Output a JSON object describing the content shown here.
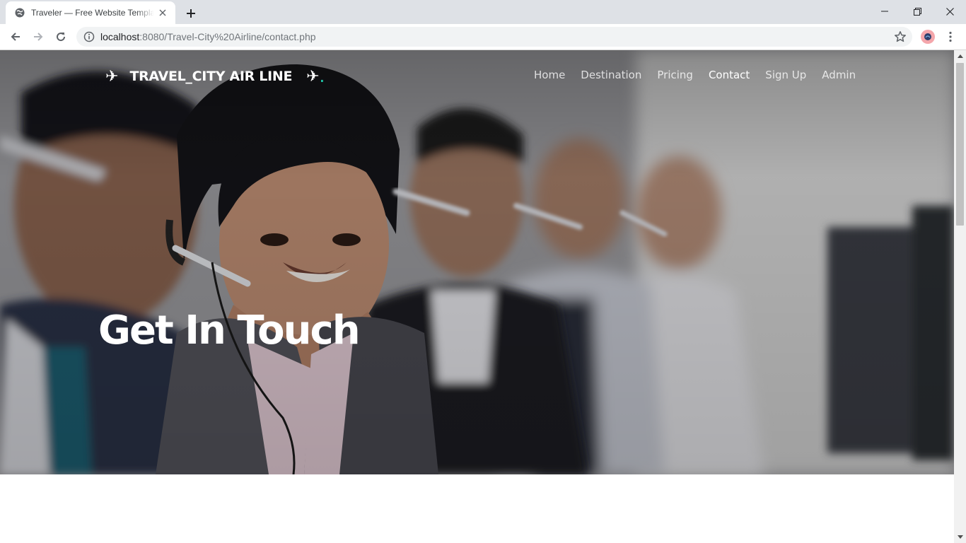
{
  "browser": {
    "tab_title": "Traveler — Free Website Template",
    "url_host": "localhost",
    "url_rest": ":8080/Travel-City%20Airline/contact.php",
    "new_tab_icon": "plus-icon",
    "accent": "#dee1e6"
  },
  "site": {
    "logo_text": "TRAVEL_CITY AIR LINE",
    "logo_icon": "airplane-icon",
    "logo_dot": ".",
    "logo_dot_color": "#1ec0a4",
    "nav": [
      {
        "label": "Home"
      },
      {
        "label": "Destination"
      },
      {
        "label": "Pricing"
      },
      {
        "label": "Contact",
        "active": true
      },
      {
        "label": "Sign Up"
      },
      {
        "label": "Admin"
      }
    ]
  },
  "hero": {
    "title": "Get In Touch"
  }
}
